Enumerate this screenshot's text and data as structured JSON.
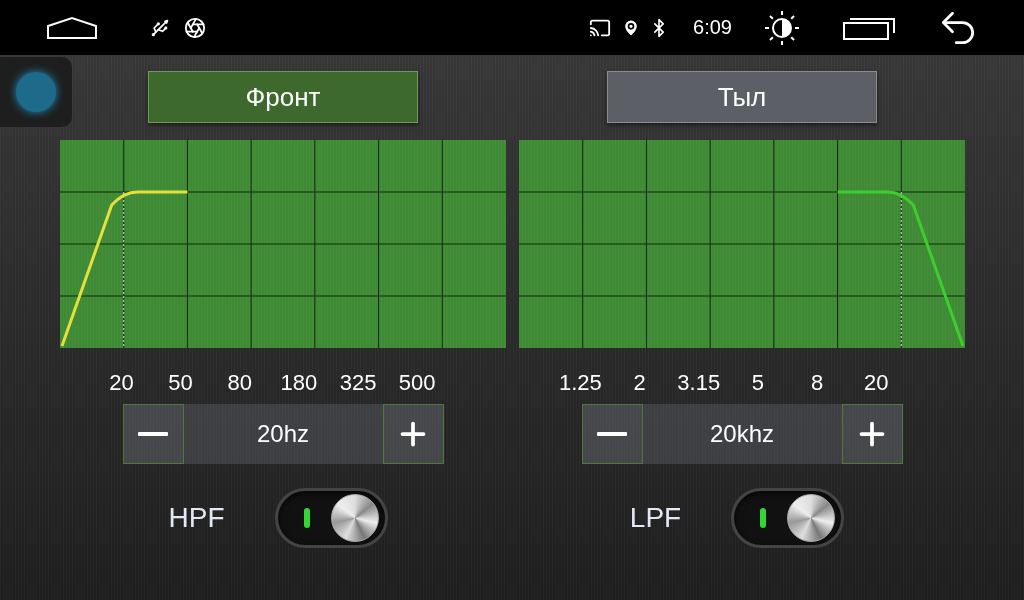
{
  "status_bar": {
    "time": "6:09"
  },
  "tabs": [
    {
      "label": "Фронт",
      "selected": true
    },
    {
      "label": "Тыл",
      "selected": false
    }
  ],
  "panels": [
    {
      "kind": "highpass",
      "color": "#e6e03c",
      "axis_labels": [
        "20",
        "50",
        "80",
        "180",
        "325",
        "500"
      ],
      "value": "20hz",
      "filter": {
        "label": "HPF",
        "on": true
      }
    },
    {
      "kind": "lowpass",
      "color": "#3ccf2c",
      "axis_labels": [
        "1.25",
        "2",
        "3.15",
        "5",
        "8",
        "20"
      ],
      "value": "20khz",
      "filter": {
        "label": "LPF",
        "on": true
      }
    }
  ]
}
